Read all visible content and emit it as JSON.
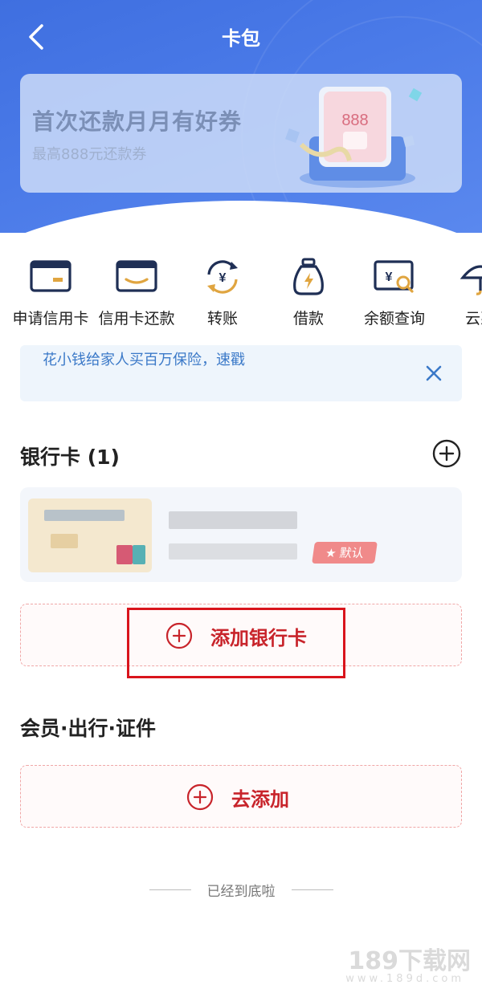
{
  "header": {
    "title": "卡包",
    "banner": {
      "title": "首次还款月月有好券",
      "subtitle": "最高888元还款券",
      "badge_text": "888",
      "active_dot": 5
    }
  },
  "quick_actions": [
    {
      "label": "申请信用卡",
      "icon": "credit-card-icon"
    },
    {
      "label": "信用卡还款",
      "icon": "card-repay-icon"
    },
    {
      "label": "转账",
      "icon": "transfer-icon"
    },
    {
      "label": "借款",
      "icon": "loan-bag-icon"
    },
    {
      "label": "余额查询",
      "icon": "balance-search-icon"
    },
    {
      "label": "云惠",
      "icon": "umbrella-icon"
    }
  ],
  "notice": {
    "text": "花小钱给家人买百万保险，速戳"
  },
  "bank_section": {
    "title": "银行卡 (1)",
    "default_tag": "默认",
    "add_label": "添加银行卡"
  },
  "member_section": {
    "title": "会员·出行·证件",
    "add_label": "去添加"
  },
  "footer": {
    "text": "已经到底啦"
  },
  "watermark": {
    "main": "189下载网",
    "sub": "www.189d.com"
  },
  "colors": {
    "brand_blue": "#4a7ae8",
    "accent_red": "#c8242b",
    "highlight": "#d9141c"
  }
}
